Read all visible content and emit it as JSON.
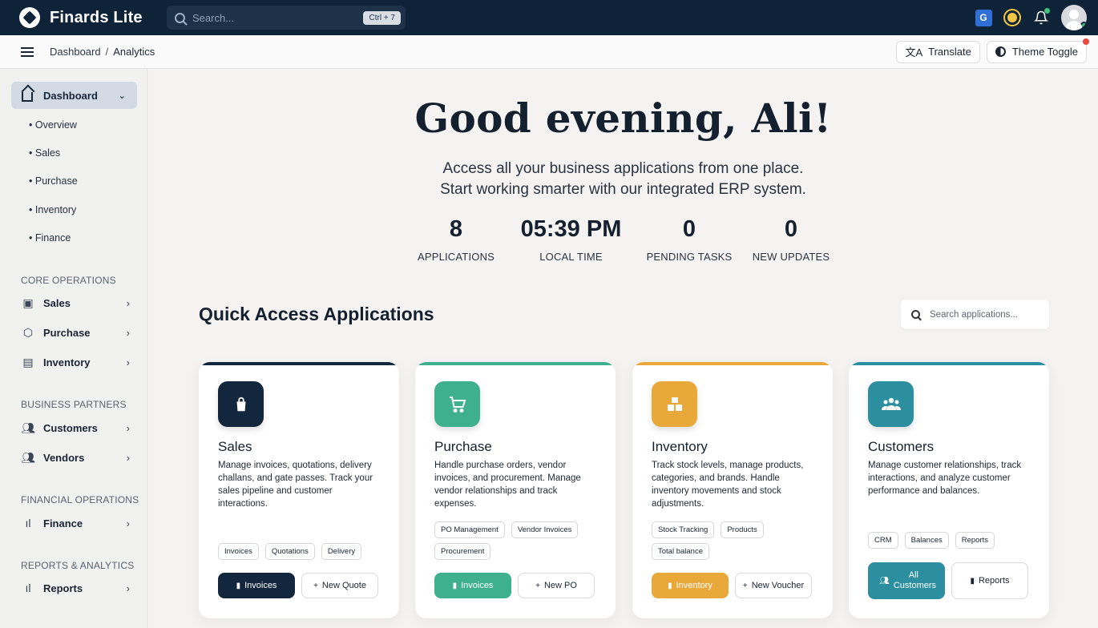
{
  "app": {
    "name": "Finards Lite"
  },
  "search": {
    "placeholder": "Search...",
    "shortcut": "Ctrl + 7"
  },
  "topbar": {
    "translate_badge": "G"
  },
  "breadcrumb": {
    "root": "Dashboard",
    "separator": "/",
    "current": "Analytics"
  },
  "header_actions": {
    "translate": "Translate",
    "theme_toggle": "Theme Toggle"
  },
  "sidebar": {
    "dashboard": {
      "label": "Dashboard",
      "sub_items": [
        "Overview",
        "Sales",
        "Purchase",
        "Inventory",
        "Finance"
      ]
    },
    "sections": [
      {
        "label": "CORE OPERATIONS",
        "items": [
          "Sales",
          "Purchase",
          "Inventory"
        ]
      },
      {
        "label": "BUSINESS PARTNERS",
        "items": [
          "Customers",
          "Vendors"
        ]
      },
      {
        "label": "FINANCIAL OPERATIONS",
        "items": [
          "Finance"
        ]
      },
      {
        "label": "REPORTS & ANALYTICS",
        "items": [
          "Reports"
        ]
      }
    ]
  },
  "hero": {
    "greeting": "Good evening, Ali!",
    "line1": "Access all your business applications from one place.",
    "line2": "Start working smarter with our integrated ERP system."
  },
  "stats": [
    {
      "value": "8",
      "label": "APPLICATIONS"
    },
    {
      "value": "05:39 PM",
      "label": "LOCAL TIME"
    },
    {
      "value": "0",
      "label": "PENDING TASKS"
    },
    {
      "value": "0",
      "label": "NEW UPDATES"
    }
  ],
  "quick_access": {
    "title": "Quick Access Applications",
    "search_placeholder": "Search applications..."
  },
  "cards": [
    {
      "title": "Sales",
      "description": "Manage invoices, quotations, delivery challans, and gate passes. Track your sales pipeline and customer interactions.",
      "tags": [
        "Invoices",
        "Quotations",
        "Delivery"
      ],
      "primary": "Invoices",
      "secondary": "New Quote",
      "color": "#12263d",
      "icon": "shopping-bag-icon"
    },
    {
      "title": "Purchase",
      "description": "Handle purchase orders, vendor invoices, and procurement. Manage vendor relationships and track expenses.",
      "tags": [
        "PO Management",
        "Vendor Invoices",
        "Procurement"
      ],
      "primary": "Invoices",
      "secondary": "New PO",
      "color": "#3fb08e",
      "icon": "cart-icon"
    },
    {
      "title": "Inventory",
      "description": "Track stock levels, manage products, categories, and brands. Handle inventory movements and stock adjustments.",
      "tags": [
        "Stock Tracking",
        "Products",
        "Total balance"
      ],
      "primary": "Inventory",
      "secondary": "New Voucher",
      "color": "#e9a93a",
      "icon": "boxes-icon"
    },
    {
      "title": "Customers",
      "description": "Manage customer relationships, track interactions, and analyze customer performance and balances.",
      "tags": [
        "CRM",
        "Balances",
        "Reports"
      ],
      "primary": "All Customers",
      "secondary": "Reports",
      "color": "#2b8fa0",
      "icon": "users-icon"
    }
  ]
}
